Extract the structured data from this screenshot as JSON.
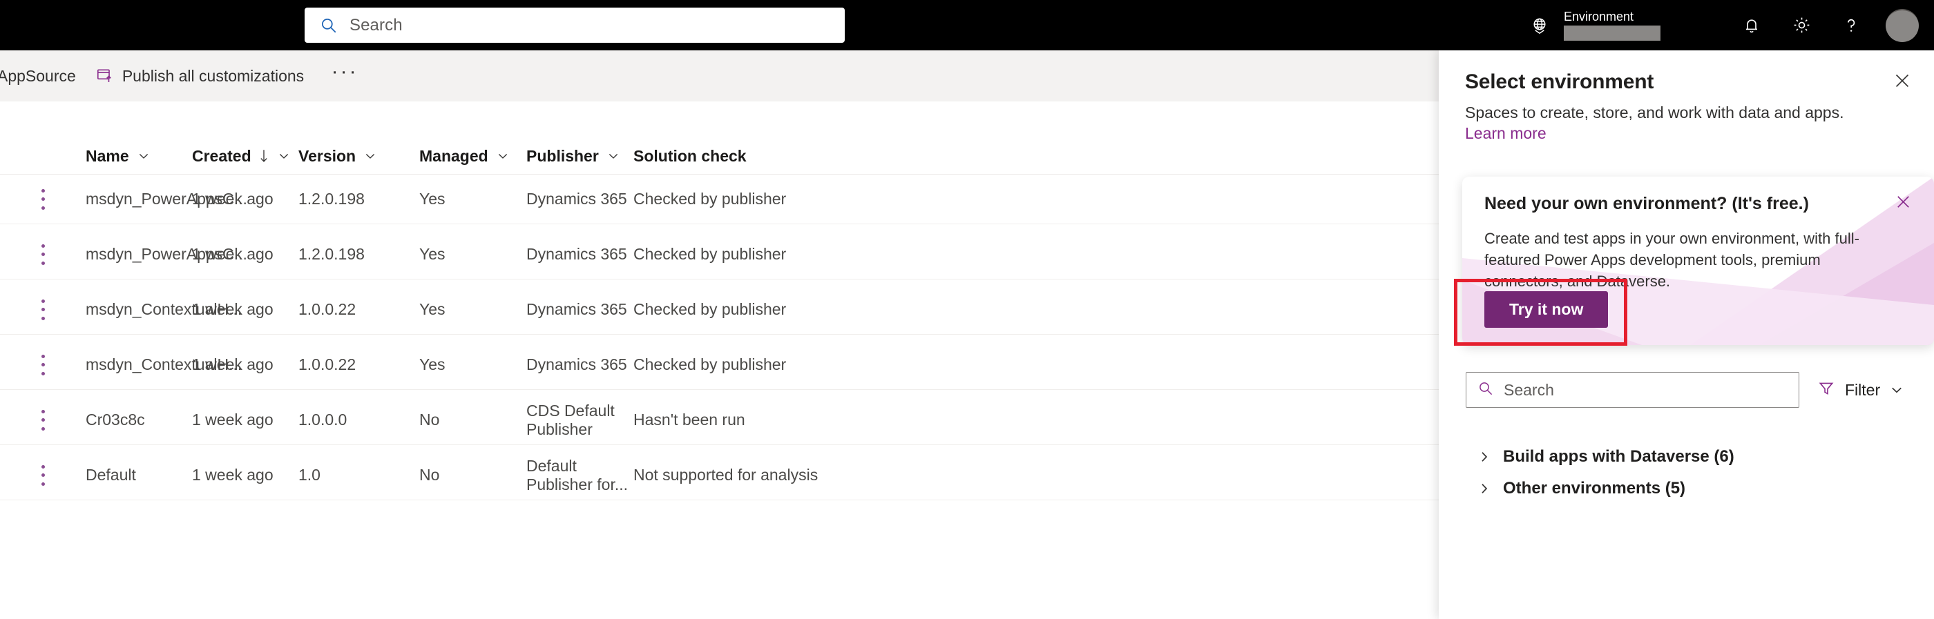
{
  "topbar": {
    "search": {
      "placeholder": "Search",
      "icon": "search-icon"
    },
    "environment_label": "Environment",
    "icons": {
      "globe": "globe-icon",
      "notifications": "bell-icon",
      "settings": "gear-icon",
      "help": "question-mark-icon",
      "avatar": "user-avatar"
    }
  },
  "commandbar": {
    "items": [
      {
        "label": "AppSource",
        "icon": ""
      },
      {
        "label": "Publish all customizations",
        "icon": "publish-icon"
      }
    ],
    "overflow": "···"
  },
  "grid": {
    "columns": [
      {
        "label": "Name",
        "sortable": true,
        "sorted": false
      },
      {
        "label": "Created",
        "sortable": true,
        "sorted": true,
        "direction": "desc"
      },
      {
        "label": "Version",
        "sortable": true,
        "sorted": false
      },
      {
        "label": "Managed",
        "sortable": true,
        "sorted": false
      },
      {
        "label": "Publisher",
        "sortable": true,
        "sorted": false
      },
      {
        "label": "Solution check",
        "sortable": false,
        "sorted": false
      }
    ],
    "rows": [
      {
        "name": "msdyn_PowerAppsC...",
        "created": "1 week ago",
        "version": "1.2.0.198",
        "managed": "Yes",
        "publisher": "Dynamics 365",
        "solution_check": "Checked by publisher"
      },
      {
        "name": "msdyn_PowerAppsC...",
        "created": "1 week ago",
        "version": "1.2.0.198",
        "managed": "Yes",
        "publisher": "Dynamics 365",
        "solution_check": "Checked by publisher"
      },
      {
        "name": "msdyn_ContextualH...",
        "created": "1 week ago",
        "version": "1.0.0.22",
        "managed": "Yes",
        "publisher": "Dynamics 365",
        "solution_check": "Checked by publisher"
      },
      {
        "name": "msdyn_ContextualH...",
        "created": "1 week ago",
        "version": "1.0.0.22",
        "managed": "Yes",
        "publisher": "Dynamics 365",
        "solution_check": "Checked by publisher"
      },
      {
        "name": "Cr03c8c",
        "created": "1 week ago",
        "version": "1.0.0.0",
        "managed": "No",
        "publisher": "CDS Default Publisher",
        "solution_check": "Hasn't been run"
      },
      {
        "name": "Default",
        "created": "1 week ago",
        "version": "1.0",
        "managed": "No",
        "publisher": "Default Publisher for...",
        "solution_check": "Not supported for analysis"
      }
    ]
  },
  "panel": {
    "title": "Select environment",
    "subtitle": "Spaces to create, store, and work with data and apps.",
    "link": "Learn more",
    "close_icon": "close-icon",
    "search": {
      "placeholder": "Search",
      "icon": "search-icon"
    },
    "filter": {
      "label": "Filter",
      "icon": "filter-icon",
      "chevron": "chevron-down-icon"
    },
    "groups": [
      {
        "label": "Build apps with Dataverse (6)",
        "chevron": "chevron-right-icon"
      },
      {
        "label": "Other environments (5)",
        "chevron": "chevron-right-icon"
      }
    ]
  },
  "callout": {
    "title": "Need your own environment? (It's free.)",
    "body": "Create and test apps in your own environment, with full-featured Power Apps development tools, premium connectors, and Dataverse.",
    "button": "Try it now",
    "close_icon": "close-icon"
  },
  "colors": {
    "brand_purple": "#742774",
    "link_purple": "#8a2d8e",
    "topbar_black": "#000000",
    "commandbar_gray": "#f3f2f1",
    "highlight_red": "#e51f2e",
    "callout_pink": "#f2d9f0"
  }
}
